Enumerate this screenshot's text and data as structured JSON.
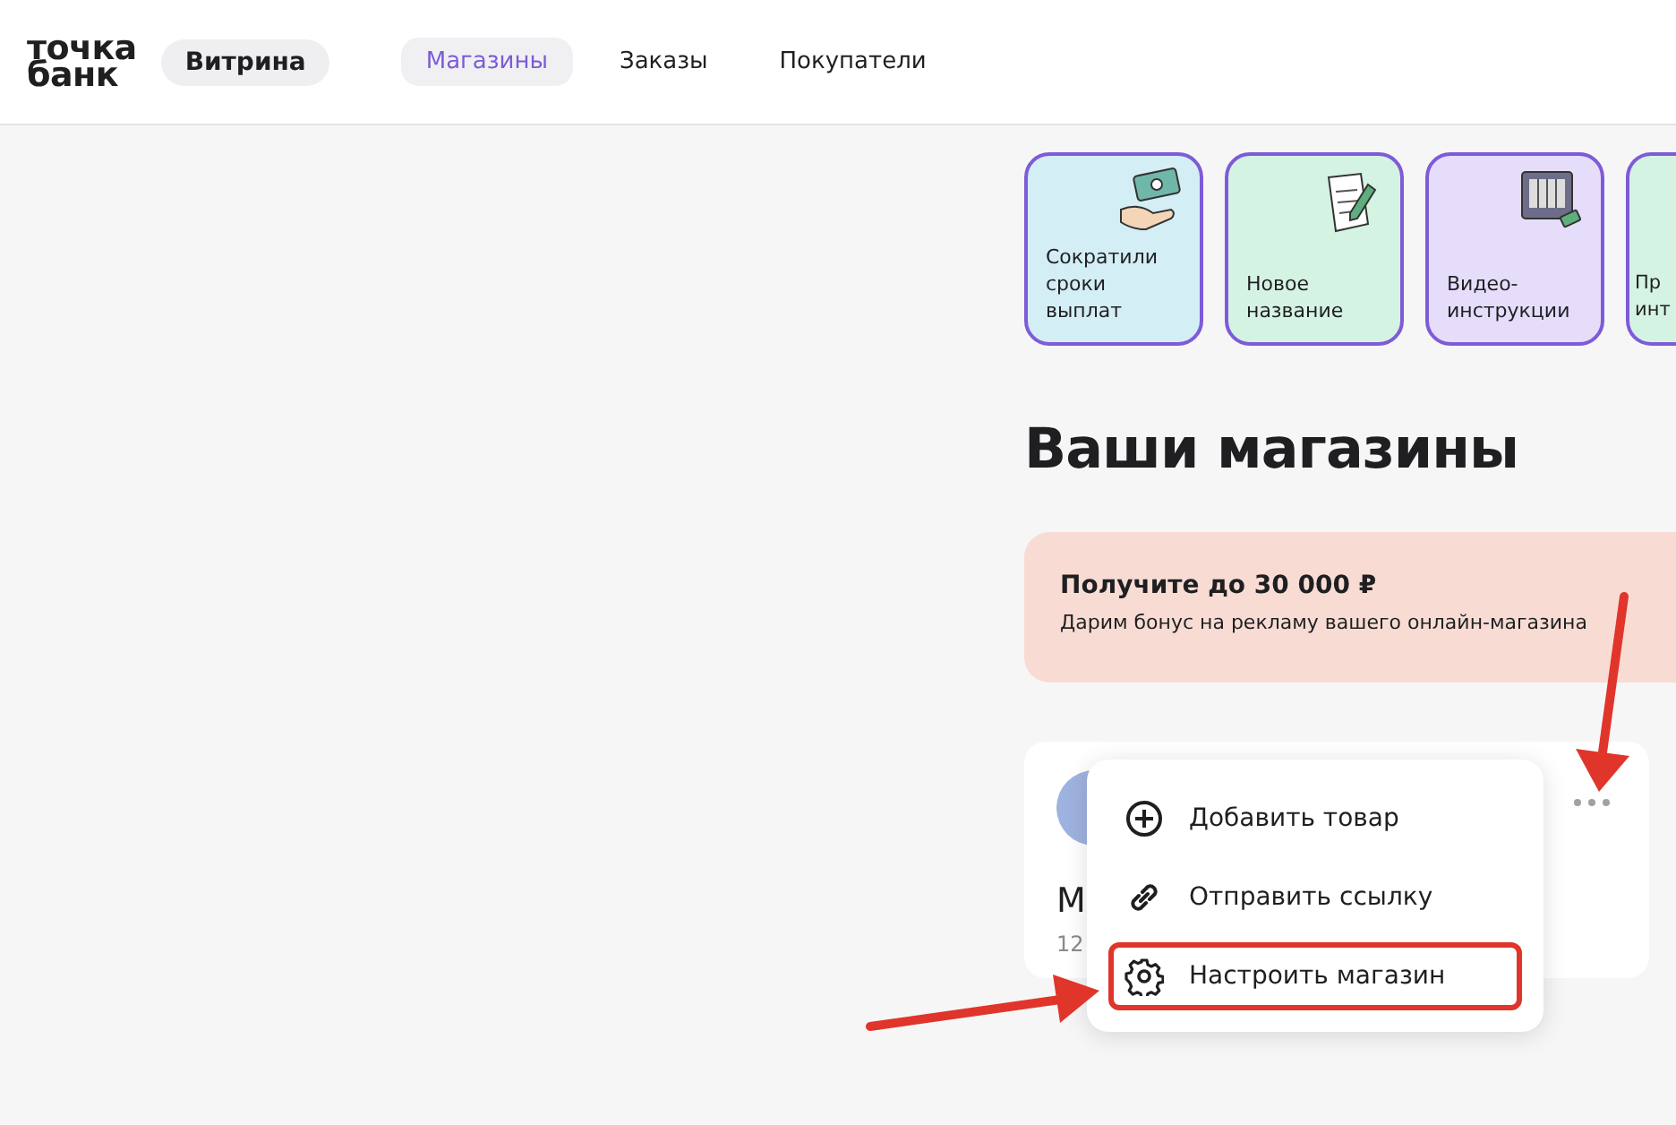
{
  "header": {
    "logo": [
      "точка",
      "банк"
    ],
    "product": "Витрина",
    "nav": [
      {
        "label": "Магазины",
        "selected": true
      },
      {
        "label": "Заказы",
        "selected": false
      },
      {
        "label": "Покупатели",
        "selected": false
      }
    ]
  },
  "stories": [
    {
      "lines": [
        "Сократили",
        "сроки",
        "выплат"
      ],
      "color": "#d3eef4",
      "kind": "money"
    },
    {
      "lines": [
        "Новое",
        "название"
      ],
      "color": "#d5f3e3",
      "kind": "document"
    },
    {
      "lines": [
        "Видео-",
        "инструкции"
      ],
      "color": "#e6ddfb",
      "kind": "screen"
    },
    {
      "lines": [
        "Пр",
        "инт"
      ],
      "color": "#d5f3e3",
      "kind": "none"
    }
  ],
  "title": "Ваши магазины",
  "banner": {
    "title": "Получите до 30 000 ₽",
    "text": "Дарим бонус на рекламу вашего онлайн-магазина"
  },
  "store": {
    "name": "М",
    "meta": "12"
  },
  "menu": [
    {
      "label": "Добавить товар",
      "kind": "plus",
      "highlighted": false
    },
    {
      "label": "Отправить ссылку",
      "kind": "link",
      "highlighted": false
    },
    {
      "label": "Настроить магазин",
      "kind": "gear",
      "highlighted": true
    }
  ]
}
